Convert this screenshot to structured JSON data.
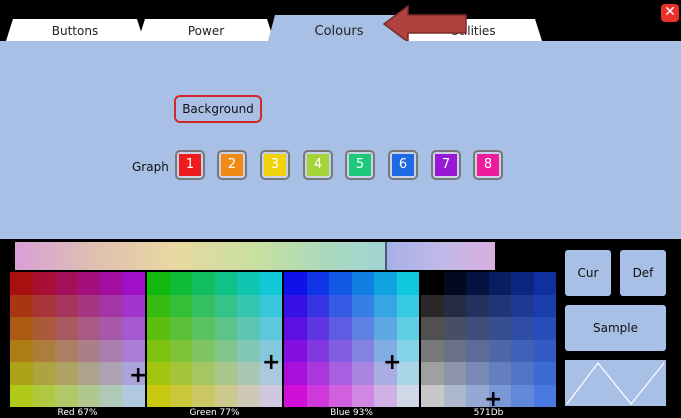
{
  "tabs": [
    {
      "label": "Buttons"
    },
    {
      "label": "Power"
    },
    {
      "label": "Colours"
    },
    {
      "label": "Utilities"
    }
  ],
  "active_tab": "Colours",
  "close_label": "✕",
  "background_button": {
    "label": "Background"
  },
  "graph": {
    "label": "Graph",
    "buttons": [
      {
        "label": "1",
        "color": "#ee1c1c"
      },
      {
        "label": "2",
        "color": "#f08a14"
      },
      {
        "label": "3",
        "color": "#f2d20c"
      },
      {
        "label": "4",
        "color": "#a2d43a"
      },
      {
        "label": "5",
        "color": "#1ec87a"
      },
      {
        "label": "6",
        "color": "#1e6ae4"
      },
      {
        "label": "7",
        "color": "#9818d8"
      },
      {
        "label": "8",
        "color": "#ee1c9a"
      }
    ]
  },
  "color_grids": [
    {
      "name": "red",
      "label": "Red 67%",
      "tl": "#a81010",
      "tr": "#a010c8",
      "bl": "#b0c818",
      "br": "#b0c8e0"
    },
    {
      "name": "green",
      "label": "Green 77%",
      "tl": "#10b810",
      "tr": "#10c8d8",
      "bl": "#c8c810",
      "br": "#d0c8e0"
    },
    {
      "name": "blue",
      "label": "Blue 93%",
      "tl": "#1010e8",
      "tr": "#10c8e0",
      "bl": "#d010d8",
      "br": "#d0d8e8"
    },
    {
      "name": "dark",
      "label": "571Db",
      "tl": "#000000",
      "tr": "#1030a0",
      "bl": "#c8c8c8",
      "br": "#4878e0"
    }
  ],
  "side_buttons": {
    "cur": "Cur",
    "def": "Def",
    "sample": "Sample"
  },
  "colors": {
    "panel": "#a8bfe6",
    "arrow": "#b0413e",
    "close": "#e8312a"
  }
}
